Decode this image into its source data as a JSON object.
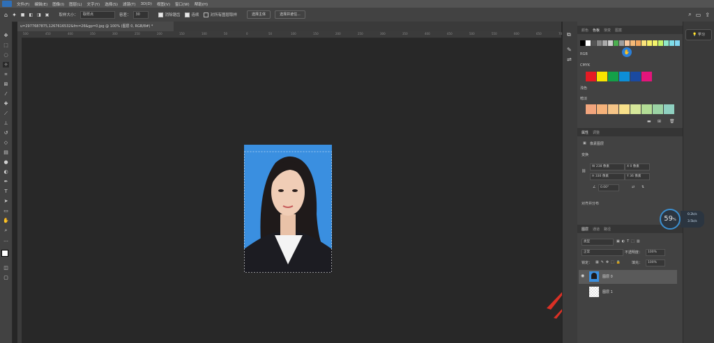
{
  "menubar": {
    "items": [
      "文件(F)",
      "编辑(E)",
      "图像(I)",
      "图层(L)",
      "文字(Y)",
      "选择(S)",
      "滤镜(T)",
      "3D(D)",
      "视图(V)",
      "窗口(W)",
      "帮助(H)"
    ]
  },
  "options": {
    "brush_size_label": "取样大小：",
    "brush_size_value": "取样点",
    "tolerance_label": "容差：",
    "tolerance_value": "30",
    "antialias_label": "消除锯齿",
    "contiguous_label": "连续",
    "sample_all_label": "对所有图层取样",
    "select_subject_label": "选择主体",
    "select_mask_label": "选择并遮住..."
  },
  "document": {
    "tab_title": "u=2977687875,1267616532&fm=26&gp=0.jpg @ 100% (图层 0, RGB/8#) *"
  },
  "ruler": {
    "ticks": [
      "500",
      "450",
      "400",
      "350",
      "300",
      "250",
      "200",
      "150",
      "100",
      "50",
      "0",
      "50",
      "100",
      "150",
      "200",
      "250",
      "300",
      "350",
      "400",
      "450",
      "500",
      "550",
      "600",
      "650",
      "700"
    ]
  },
  "tools": [
    "move-icon",
    "marquee-icon",
    "lasso-icon",
    "magic-wand-icon",
    "crop-icon",
    "frame-icon",
    "eyedropper-icon",
    "healing-icon",
    "brush-icon",
    "stamp-icon",
    "history-brush-icon",
    "eraser-icon",
    "gradient-icon",
    "blur-icon",
    "dodge-icon",
    "pen-icon",
    "type-icon",
    "path-select-icon",
    "shape-icon",
    "hand-icon",
    "zoom-icon",
    "more-icon"
  ],
  "swatches": {
    "tabs": [
      "颜色",
      "色板",
      "渐变",
      "图案"
    ],
    "groups": {
      "rgb": "RGB",
      "cmyk": "CMYK",
      "light": "浅色",
      "pastel": "暗淡"
    },
    "top_row": [
      "#000000",
      "#ffffff",
      "#555555",
      "#888888",
      "#aaaaaa",
      "#cfcfcf",
      "#4caf50",
      "#9e9e9e",
      "#f7c8a0",
      "#f5b977",
      "#f2a65e",
      "#fbe37a",
      "#f8ef67",
      "#f3f36b",
      "#c3f36b",
      "#8fe8c8",
      "#7fdde8",
      "#82d7f2"
    ],
    "cmyk": [
      "#e51b24",
      "#f7e400",
      "#14a048",
      "#0d8ed6",
      "#1a4aa1",
      "#e3157b"
    ],
    "pastel": [
      "#f2a57d",
      "#f5b27a",
      "#f5c487",
      "#f8e08a",
      "#d6e79a",
      "#b3dd96",
      "#9bd3a4",
      "#8fd0c0"
    ]
  },
  "properties": {
    "tabs": [
      "属性",
      "调整"
    ],
    "kind_label": "像素图层",
    "transform_label": "变换",
    "w": "W 238 像素",
    "x": "X 0 像素",
    "h": "H 330 像素",
    "y": "Y 36 像素",
    "angle": "0.00°",
    "align_label": "对齐并分布"
  },
  "layers": {
    "tabs": [
      "图层",
      "通道",
      "路径"
    ],
    "filter_label": "类型",
    "blend_mode": "正常",
    "opacity_label": "不透明度：",
    "opacity_value": "100%",
    "lock_label": "锁定：",
    "fill_label": "填充：",
    "fill_value": "100%",
    "items": [
      {
        "name": "图层 0",
        "selected": true
      },
      {
        "name": "图层 1",
        "selected": false
      }
    ]
  },
  "learn_label": "学习",
  "perf": {
    "value": "59",
    "unit": "%",
    "up": "0.2k/s",
    "down": "3.5k/s"
  },
  "colors": {
    "photo_bg": "#3a8fe0",
    "accent": "#3b8fd0",
    "arrow": "#d93025"
  }
}
